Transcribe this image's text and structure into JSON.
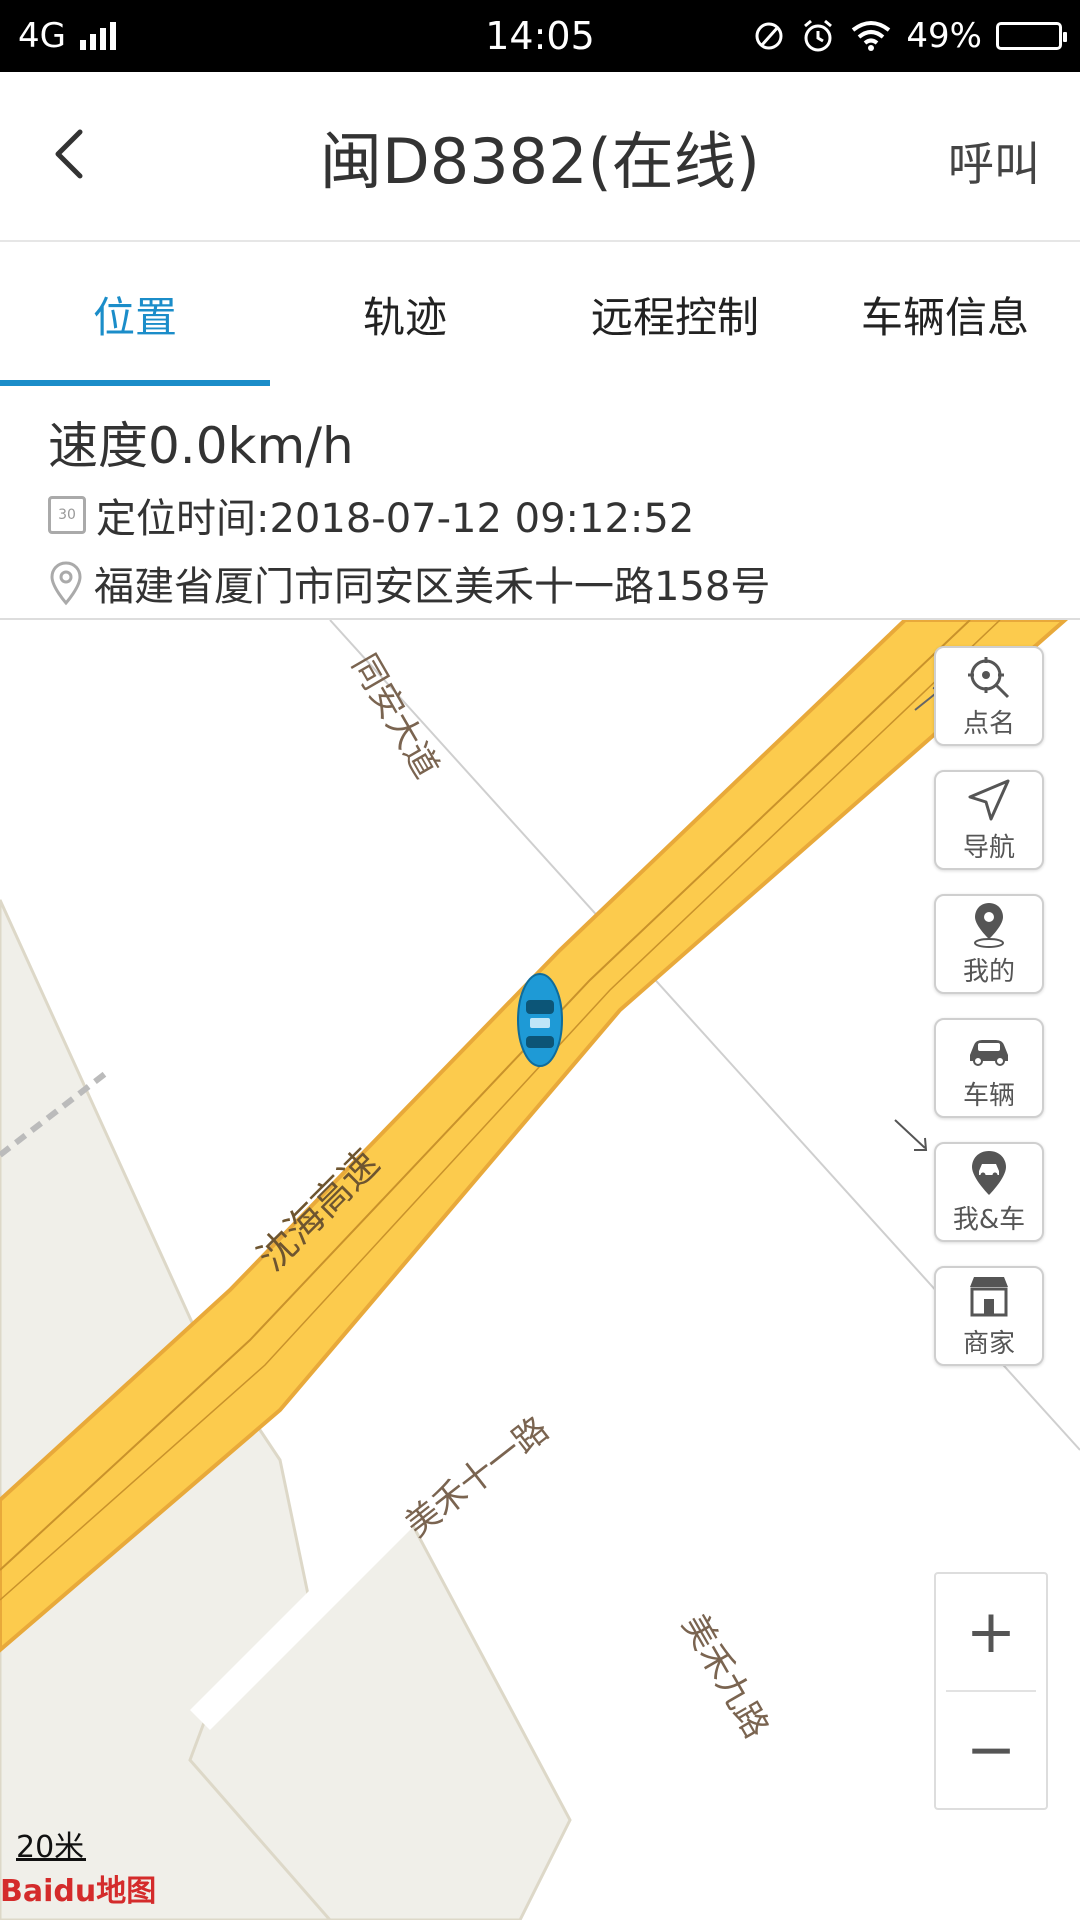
{
  "status_bar": {
    "network": "4G",
    "time": "14:05",
    "battery": "49%"
  },
  "header": {
    "title": "闽D8382(在线)",
    "call_label": "呼叫"
  },
  "tabs": [
    {
      "label": "位置",
      "active": true
    },
    {
      "label": "轨迹",
      "active": false
    },
    {
      "label": "远程控制",
      "active": false
    },
    {
      "label": "车辆信息",
      "active": false
    }
  ],
  "info": {
    "speed": "速度0.0km/h",
    "location_time": "定位时间:2018-07-12 09:12:52",
    "address": "福建省厦门市同安区美禾十一路158号",
    "calendar_icon_text": "30"
  },
  "map": {
    "road_labels": {
      "tongan": "同安大道",
      "shenhai": "沈海高速",
      "meihe11": "美禾十一路",
      "meihe9": "美禾九路"
    },
    "side_buttons": [
      {
        "label": "点名",
        "icon": "locate-search-icon"
      },
      {
        "label": "导航",
        "icon": "navigation-icon"
      },
      {
        "label": "我的",
        "icon": "my-location-pin-icon"
      },
      {
        "label": "车辆",
        "icon": "car-icon"
      },
      {
        "label": "我&车",
        "icon": "me-and-car-icon"
      },
      {
        "label": "商家",
        "icon": "store-icon"
      }
    ],
    "zoom_in": "+",
    "zoom_out": "−",
    "scale": "20米",
    "logo": "Baidu地图",
    "colors": {
      "highway": "#fccb4d",
      "highway_edge": "#e8a93a",
      "land": "#f0efe9",
      "accent": "#1b8dc9"
    }
  }
}
